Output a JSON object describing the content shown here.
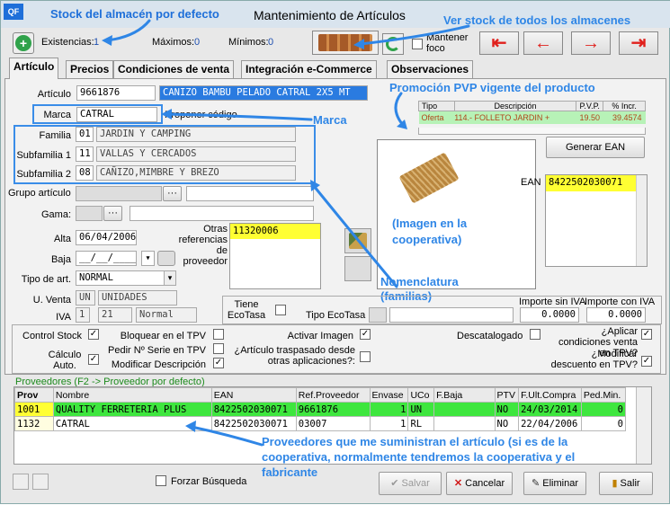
{
  "window": {
    "title": "Mantenimiento de Artículos",
    "app_icon": "QF"
  },
  "annotations": {
    "stock": "Stock del almacén por defecto",
    "all_stock": "Ver stock de todos los almacenes",
    "promo": "Promoción PVP vigente del producto",
    "marca": "Marca",
    "image": "(Imagen en la cooperativa)",
    "nomen": "Nomenclatura (familias)",
    "prov": "Proveedores que me suministran el artículo (si es de la cooperativa, normalmente tendremos la cooperativa y el fabricante"
  },
  "toolbar": {
    "existencias_label": "Existencias:",
    "existencias_value": "1",
    "maximos_label": "Máximos:",
    "maximos_value": "0",
    "minimos_label": "Mínimos:",
    "minimos_value": "0",
    "mantener_foco": "Mantener foco"
  },
  "tabs": [
    "Artículo",
    "Precios",
    "Condiciones de venta",
    "Integración e-Commerce",
    "Observaciones"
  ],
  "form": {
    "articulo_label": "Artículo",
    "articulo_code": "9661876",
    "articulo_desc": "CANIZO BAMBU PELADO CATRAL 2X5 MT",
    "marca_label": "Marca",
    "marca_value": "CATRAL",
    "proponer_codigo": "Proponer código",
    "familia_label": "Familia",
    "familia_code": "01",
    "familia_desc": "JARDIN Y CAMPING",
    "subfamilia1_label": "Subfamilia 1",
    "subfamilia1_code": "11",
    "subfamilia1_desc": "VALLAS Y CERCADOS",
    "subfamilia2_label": "Subfamilia 2",
    "subfamilia2_code": "08",
    "subfamilia2_desc": "CAÑIZO,MIMBRE Y BREZO",
    "grupo_label": "Grupo artículo",
    "gama_label": "Gama:",
    "alta_label": "Alta",
    "alta_value": "06/04/2006",
    "baja_label": "Baja",
    "baja_value": "__/__/____",
    "tipo_label": "Tipo de art.",
    "tipo_value": "NORMAL",
    "uventa_label": "U. Venta",
    "uventa_code": "UN",
    "uventa_desc": "UNIDADES",
    "iva_label": "IVA",
    "iva_code": "1",
    "iva_pct": "21",
    "iva_desc": "Normal",
    "otras_ref_label": "Otras referencias de proveedor",
    "otras_ref_value": "11320006",
    "tiene_ecotasa": "Tiene EcoTasa",
    "tipo_ecotasa": "Tipo EcoTasa",
    "importe_sin_iva_label": "Importe sin IVA",
    "importe_sin_iva": "0.0000",
    "importe_con_iva_label": "Importe con IVA",
    "importe_con_iva": "0.0000",
    "ean_label": "EAN",
    "ean_value": "8422502030071",
    "generar_ean": "Generar EAN"
  },
  "promo_table": {
    "headers": [
      "Tipo",
      "Descripción",
      "P.V.P.",
      "% Incr."
    ],
    "row": [
      "Oferta",
      "114.- FOLLETO JARDIN +",
      "19.50",
      "39.4574"
    ]
  },
  "checks": {
    "control_stock": "Control Stock",
    "calculo_auto": "Cálculo Auto.",
    "bloquear_tpv": "Bloquear en el TPV",
    "pedir_serie": "Pedir Nº Serie en TPV",
    "modificar_desc": "Modificar Descripción",
    "activar_imagen": "Activar Imagen",
    "traspasado": "¿Artículo traspasado desde otras aplicaciones?:",
    "descatalogado": "Descatalogado",
    "aplicar_cond": "¿Aplicar condiciones venta en TPV?",
    "modificar_dto": "¿Modificar descuento en TPV?"
  },
  "proveedores": {
    "caption": "Proveedores (F2 -> Proveedor por defecto)",
    "headers": [
      "Prov",
      "Nombre",
      "EAN",
      "Ref.Proveedor",
      "Envase",
      "UCo",
      "F.Baja",
      "PTV",
      "F.Ult.Compra",
      "Ped.Min."
    ],
    "rows": [
      [
        "1001",
        "QUALITY FERRETERIA PLUS",
        "8422502030071",
        "9661876",
        "1",
        "UN",
        "",
        "NO",
        "24/03/2014",
        "0"
      ],
      [
        "1132",
        "CATRAL",
        "8422502030071",
        "03007",
        "1",
        "RL",
        "",
        "NO",
        "22/04/2006",
        "0"
      ]
    ]
  },
  "footer": {
    "forzar": "Forzar Búsqueda",
    "salvar": "Salvar",
    "cancelar": "Cancelar",
    "eliminar": "Eliminar",
    "salir": "Salir"
  }
}
